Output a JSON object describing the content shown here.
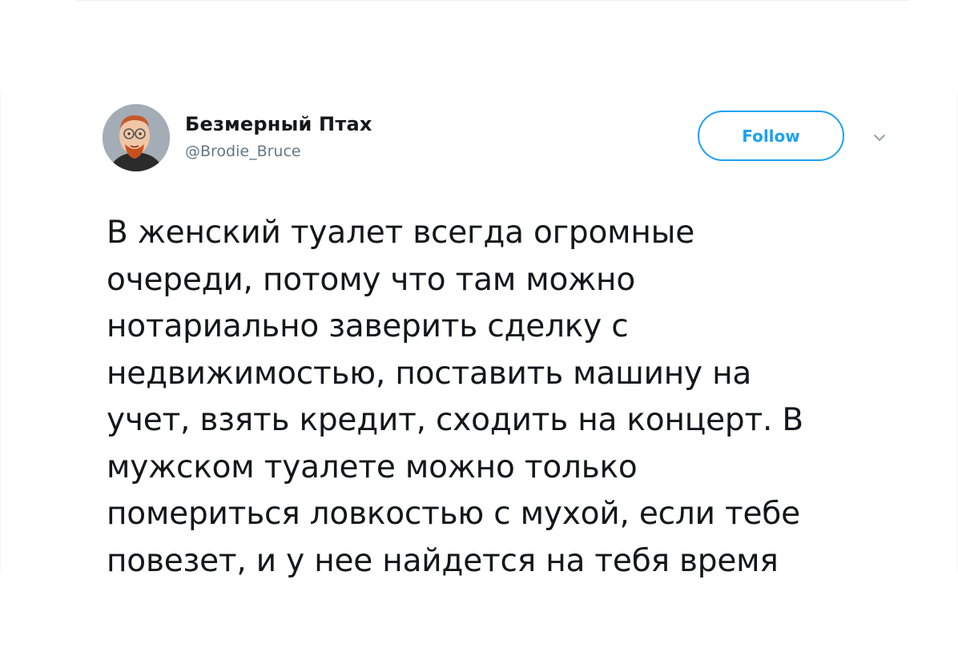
{
  "tweet": {
    "author": {
      "display_name": "Безмерный Птах",
      "handle": "@Brodie_Bruce",
      "avatar_icon": "cartoon-avatar-icon"
    },
    "follow_label": "Follow",
    "menu_icon": "chevron-down-icon",
    "text_lines": [
      "В женский туалет всегда огромные",
      "очереди, потому что там можно",
      "нотариально заверить сделку с",
      "недвижимостью, поставить машину на",
      "учет, взять кредит, сходить на концерт. В",
      "мужском туалете можно только",
      "помериться ловкостью с мухой, если тебе",
      "повезет, и у нее найдется на тебя время"
    ]
  },
  "colors": {
    "accent": "#1da1f2",
    "text": "#14171a",
    "secondary_text": "#657786"
  }
}
